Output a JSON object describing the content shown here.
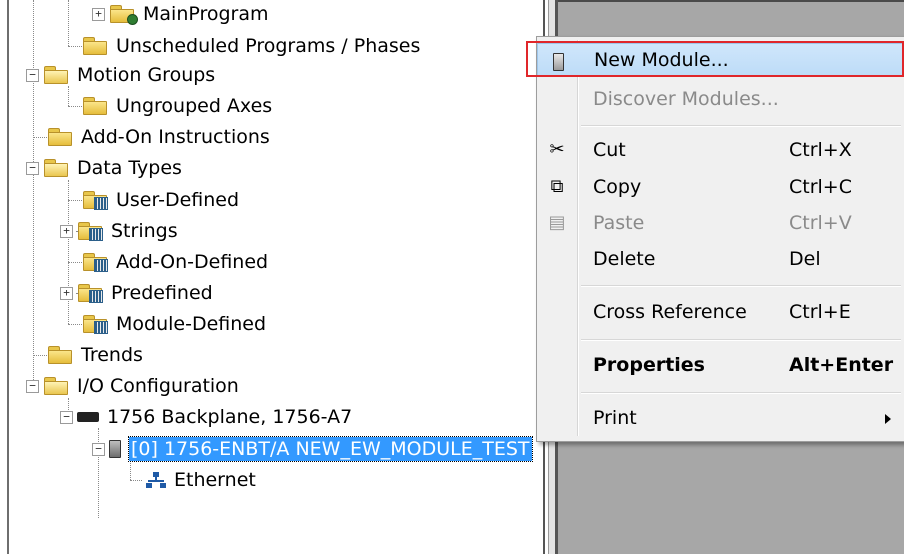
{
  "tree": {
    "items": [
      {
        "label": "MainProgram"
      },
      {
        "label": "Unscheduled Programs / Phases"
      },
      {
        "label": "Motion Groups"
      },
      {
        "label": "Ungrouped Axes"
      },
      {
        "label": "Add-On Instructions"
      },
      {
        "label": "Data Types"
      },
      {
        "label": "User-Defined"
      },
      {
        "label": "Strings"
      },
      {
        "label": "Add-On-Defined"
      },
      {
        "label": "Predefined"
      },
      {
        "label": "Module-Defined"
      },
      {
        "label": "Trends"
      },
      {
        "label": "I/O Configuration"
      },
      {
        "label": "1756 Backplane, 1756-A7"
      },
      {
        "label": "[0] 1756-ENBT/A NEW_EW_MODULE_TEST"
      },
      {
        "label": "Ethernet"
      }
    ],
    "expanders": {
      "plus": "+",
      "minus": "−"
    }
  },
  "context_menu": {
    "items": [
      {
        "label": "New Module...",
        "shortcut": "",
        "icon": "module-icon",
        "state": "highlighted"
      },
      {
        "label": "Discover Modules...",
        "shortcut": "",
        "icon": "",
        "state": "disabled"
      },
      {
        "label": "Cut",
        "shortcut": "Ctrl+X",
        "icon": "scissors-icon",
        "state": "enabled"
      },
      {
        "label": "Copy",
        "shortcut": "Ctrl+C",
        "icon": "copy-icon",
        "state": "enabled"
      },
      {
        "label": "Paste",
        "shortcut": "Ctrl+V",
        "icon": "paste-icon",
        "state": "disabled"
      },
      {
        "label": "Delete",
        "shortcut": "Del",
        "icon": "",
        "state": "enabled"
      },
      {
        "label": "Cross Reference",
        "shortcut": "Ctrl+E",
        "icon": "",
        "state": "enabled"
      },
      {
        "label": "Properties",
        "shortcut": "Alt+Enter",
        "icon": "",
        "state": "bold"
      },
      {
        "label": "Print",
        "shortcut": "",
        "icon": "",
        "state": "submenu"
      }
    ]
  },
  "colors": {
    "selection": "#3399ff",
    "menu_highlight": "#cfe6fb",
    "annotation_box": "#e0262a",
    "right_pane": "#a7a7a7"
  }
}
